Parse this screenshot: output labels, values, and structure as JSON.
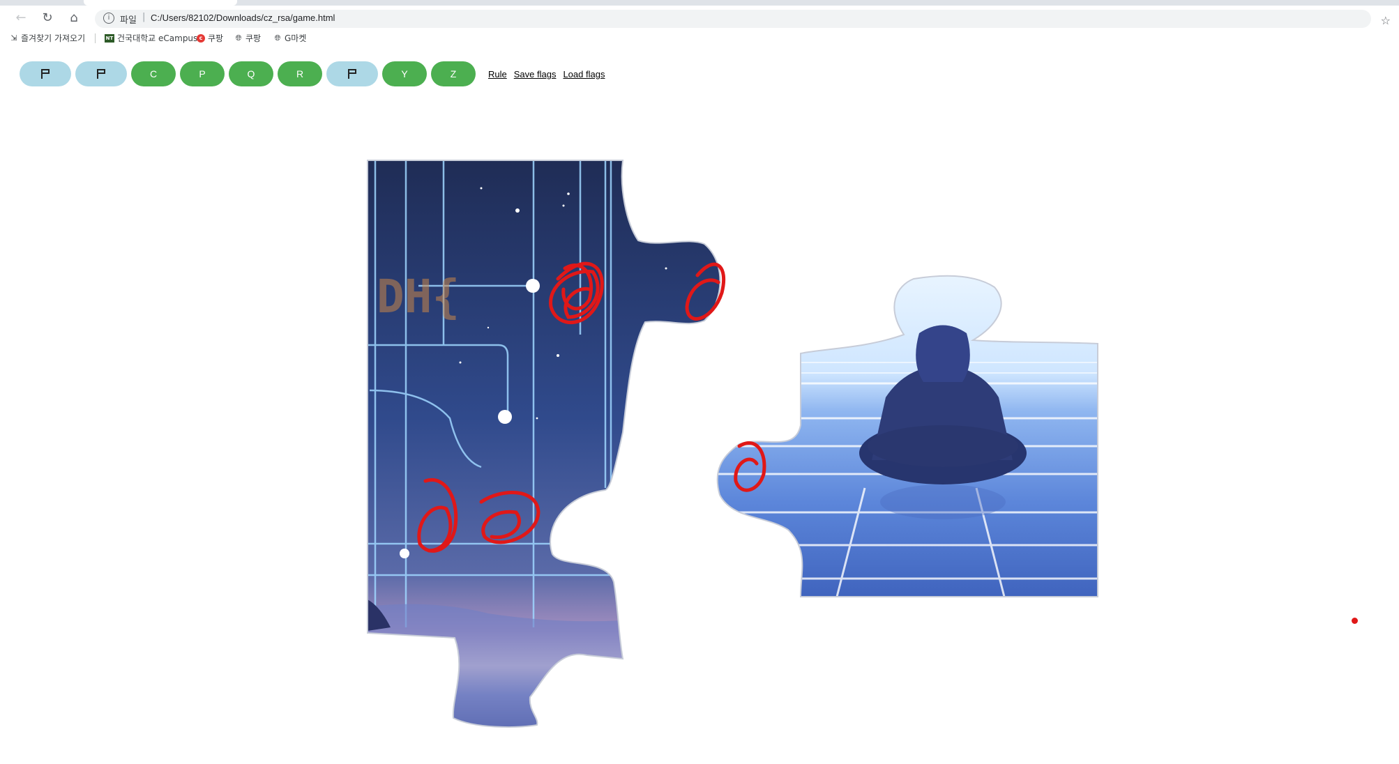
{
  "browser": {
    "scheme_label": "파일",
    "url": "C:/Users/82102/Downloads/cz_rsa/game.html",
    "bookmarks": [
      {
        "label": "즐겨찾기 가져오기",
        "icon": "import-icon"
      },
      {
        "label": "건국대학교 eCampus",
        "icon": "nt-logo-icon"
      },
      {
        "label": "쿠팡",
        "icon": "coupang-icon"
      },
      {
        "label": "쿠팡",
        "icon": "globe-icon"
      },
      {
        "label": "G마켓",
        "icon": "globe-icon"
      }
    ]
  },
  "nav": {
    "buttons": [
      {
        "type": "flag",
        "icon": "flag-icon",
        "label": ""
      },
      {
        "type": "flag",
        "icon": "flag-icon",
        "label": ""
      },
      {
        "type": "letter",
        "label": "C"
      },
      {
        "type": "letter",
        "label": "P"
      },
      {
        "type": "letter",
        "label": "Q"
      },
      {
        "type": "letter",
        "label": "R"
      },
      {
        "type": "flag",
        "icon": "flag-icon",
        "label": ""
      },
      {
        "type": "letter",
        "label": "Y"
      },
      {
        "type": "letter",
        "label": "Z"
      }
    ],
    "links": {
      "rule": "Rule",
      "save": "Save flags",
      "load": "Load flags"
    }
  },
  "puzzle": {
    "left_piece_text": "DH{",
    "colors": {
      "flag_button": "#add8e6",
      "letter_button": "#4caf50",
      "scribble": "#e01818",
      "night_sky": "#2b3f78",
      "grid_glow": "#9fd6ff"
    }
  }
}
